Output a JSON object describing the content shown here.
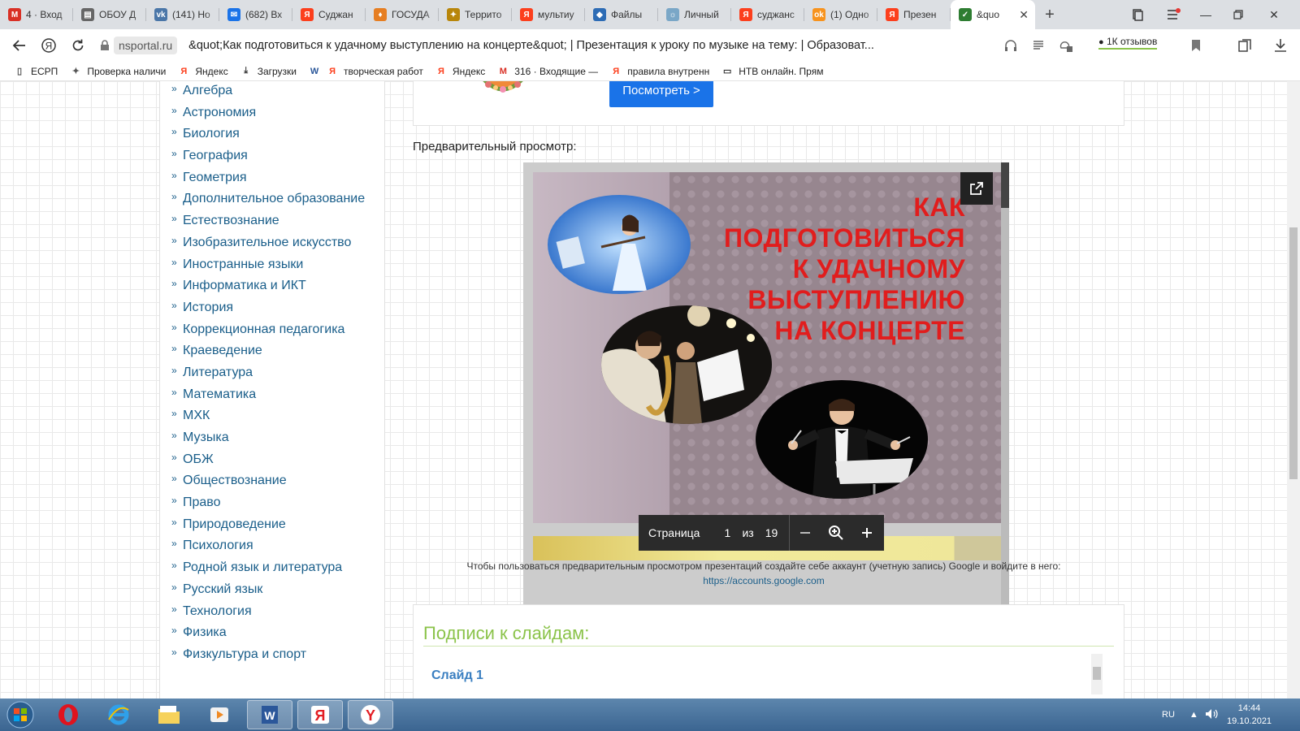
{
  "browser": {
    "tabs": [
      {
        "label": "4 · Вход",
        "icon": "gmail-icon",
        "color": "#d93025"
      },
      {
        "label": "ОБОУ Д",
        "icon": "document-icon",
        "color": "#666666"
      },
      {
        "label": "(141) Но",
        "icon": "vk-icon",
        "color": "#4a76a8"
      },
      {
        "label": "(682) Вх",
        "icon": "mail-icon",
        "color": "#1a73e8"
      },
      {
        "label": "Суджан",
        "icon": "yandex-icon",
        "color": "#fc3f1d"
      },
      {
        "label": "ГОСУДА",
        "icon": "flame-icon",
        "color": "#e67e22"
      },
      {
        "label": "Террито",
        "icon": "emblem-icon",
        "color": "#b8860b"
      },
      {
        "label": "мультиу",
        "icon": "yandex-icon",
        "color": "#fc3f1d"
      },
      {
        "label": "Файлы",
        "icon": "files-icon",
        "color": "#2d6cb5"
      },
      {
        "label": "Личный",
        "icon": "personal-icon",
        "color": "#7aa7c7"
      },
      {
        "label": "суджанс",
        "icon": "yandex-icon",
        "color": "#fc3f1d"
      },
      {
        "label": "(1) Одно",
        "icon": "odnoklassniki-icon",
        "color": "#f7931e"
      },
      {
        "label": "Презен",
        "icon": "yandex-icon",
        "color": "#fc3f1d"
      }
    ],
    "active_tab": {
      "label": "&quo",
      "icon": "nsportal-icon",
      "color": "#2e7d32"
    },
    "address": {
      "domain": "nsportal.ru",
      "title": "&quot;Как подготовиться к удачному выступлению на концерте&quot; | Презентация к уроку по музыке на тему: | Образоват..."
    },
    "reviews": "1К отзывов",
    "bookmarks": [
      {
        "label": "ЕСРП",
        "icon": "page-icon"
      },
      {
        "label": "Проверка наличи",
        "icon": "eagle-icon"
      },
      {
        "label": "Яндекс",
        "icon": "yandex-icon"
      },
      {
        "label": "Загрузки",
        "icon": "download-icon"
      },
      {
        "label": "творческая работ",
        "icon": "yandex-icon",
        "pre": "word-icon"
      },
      {
        "label": "Яндекс",
        "icon": "yandex-icon"
      },
      {
        "label": "316 · Входящие —",
        "icon": "gmail-icon"
      },
      {
        "label": "правила внутренн",
        "icon": "yandex-icon"
      },
      {
        "label": "НТВ онлайн. Прям",
        "icon": "monitor-icon"
      }
    ]
  },
  "sidebar": {
    "items": [
      {
        "label": "Алгебра"
      },
      {
        "label": "Астрономия"
      },
      {
        "label": "Биология"
      },
      {
        "label": "География"
      },
      {
        "label": "Геометрия"
      },
      {
        "label": "Дополнительное образование"
      },
      {
        "label": "Естествознание"
      },
      {
        "label": "Изобразительное искусство"
      },
      {
        "label": "Иностранные языки"
      },
      {
        "label": "Информатика и ИКТ"
      },
      {
        "label": "История"
      },
      {
        "label": "Коррекционная педагогика"
      },
      {
        "label": "Краеведение"
      },
      {
        "label": "Литература"
      },
      {
        "label": "Математика"
      },
      {
        "label": "МХК"
      },
      {
        "label": "Музыка"
      },
      {
        "label": "ОБЖ"
      },
      {
        "label": "Обществознание"
      },
      {
        "label": "Право"
      },
      {
        "label": "Природоведение"
      },
      {
        "label": "Психология"
      },
      {
        "label": "Родной язык и литература"
      },
      {
        "label": "Русский язык"
      },
      {
        "label": "Технология"
      },
      {
        "label": "Физика"
      },
      {
        "label": "Физкультура и спорт"
      }
    ]
  },
  "main": {
    "view_button": "Посмотреть >",
    "preview_label": "Предварительный просмотр:",
    "slide": {
      "title": "КАК ПОДГОТОВИТЬСЯ К УДАЧНОМУ ВЫСТУПЛЕНИЮ НА КОНЦЕРТЕ"
    },
    "pager": {
      "page_label": "Страница",
      "page": "1",
      "of": "из",
      "total": "19"
    },
    "note": "Чтобы пользоваться предварительным просмотром презентаций создайте себе аккаунт (учетную запись) Google и войдите в него:",
    "note_link": "https://accounts.google.com",
    "captions": {
      "heading": "Подписи к слайдам:",
      "slide1": "Слайд 1"
    }
  },
  "taskbar": {
    "lang": "RU",
    "time": "14:44",
    "date": "19.10.2021"
  }
}
